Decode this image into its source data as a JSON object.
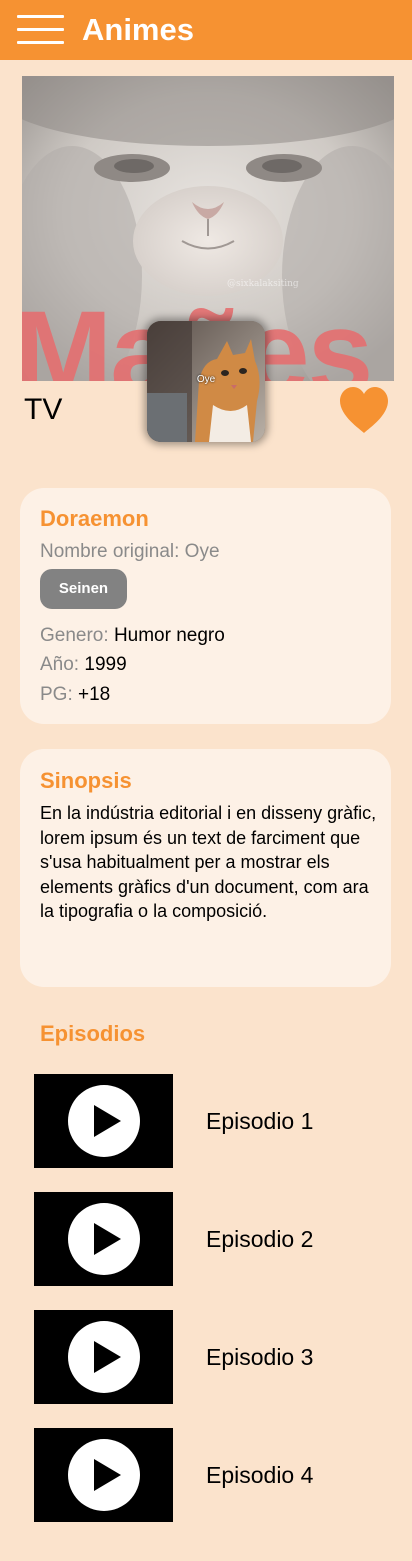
{
  "header": {
    "title": "Animes",
    "menu_icon": "hamburger-menu-icon",
    "background": "#f69232"
  },
  "banner": {
    "caption": "Mañes",
    "watermark": "@sixkalaksiting"
  },
  "thumbnail": {
    "caption": "Oye"
  },
  "type_label": "TV",
  "favorite_icon": "heart-icon",
  "info": {
    "title": "Doraemon",
    "original_name": "Nombre original: Oye",
    "tag": "Seinen",
    "genre_label": "Genero:",
    "genre_value": "Humor negro",
    "year_label": "Año:",
    "year_value": "1999",
    "pg_label": "PG:",
    "pg_value": "+18"
  },
  "synopsis": {
    "title": "Sinopsis",
    "text": "En la indústria editorial i en disseny gràfic, lorem ipsum és un text de farciment que s'usa habitualment per a mostrar els elements gràfics d'un document, com ara la tipografia o la  composició."
  },
  "episodes": {
    "title": "Episodios",
    "items": [
      {
        "label": "Episodio 1",
        "icon": "play-icon"
      },
      {
        "label": "Episodio 2",
        "icon": "play-icon"
      },
      {
        "label": "Episodio 3",
        "icon": "play-icon"
      },
      {
        "label": "Episodio 4",
        "icon": "play-icon"
      }
    ]
  },
  "colors": {
    "accent": "#f69232",
    "page_background": "#fbe3cc",
    "card_background": "#fdf1e6",
    "tag_background": "#828282"
  }
}
